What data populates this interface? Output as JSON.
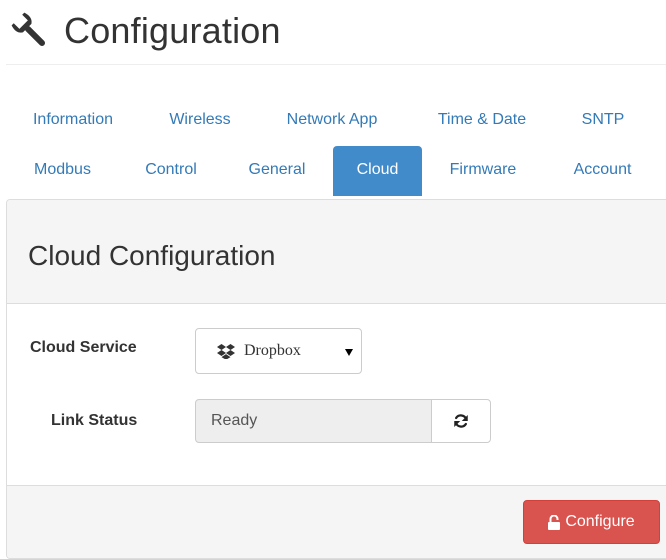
{
  "page": {
    "title": "Configuration",
    "icon": "wrench-icon"
  },
  "tabs": {
    "row1": [
      {
        "label": "Information"
      },
      {
        "label": "Wireless"
      },
      {
        "label": "Network App"
      },
      {
        "label": "Time & Date"
      },
      {
        "label": "SNTP"
      }
    ],
    "row2": [
      {
        "label": "Modbus"
      },
      {
        "label": "Control"
      },
      {
        "label": "General"
      },
      {
        "label": "Cloud",
        "active": true
      },
      {
        "label": "Firmware"
      },
      {
        "label": "Account"
      }
    ]
  },
  "panel": {
    "title": "Cloud Configuration",
    "cloud_service": {
      "label": "Cloud Service",
      "value": "Dropbox",
      "icon": "dropbox-icon"
    },
    "link_status": {
      "label": "Link Status",
      "value": "Ready",
      "refresh_icon": "refresh-icon"
    },
    "configure_button": {
      "label": "Configure",
      "icon": "unlock-icon"
    }
  },
  "colors": {
    "link": "#337ab7",
    "active_tab": "#428bca",
    "danger": "#d9534f",
    "panel_bg": "#f5f5f5"
  }
}
